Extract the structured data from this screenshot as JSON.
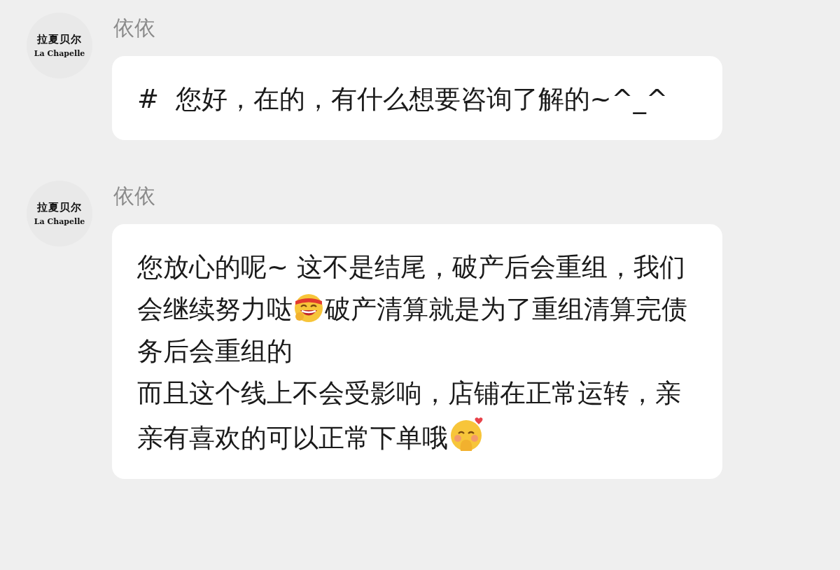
{
  "messages": [
    {
      "sender": "依依",
      "avatar": {
        "name_cn": "拉夏贝尔",
        "name_en": "La Chapelle"
      },
      "paragraphs": [
        [
          {
            "kind": "text",
            "text": "#  您好，在的，有什么想要咨询了解的~^_^"
          }
        ]
      ]
    },
    {
      "sender": "依依",
      "avatar": {
        "name_cn": "拉夏贝尔",
        "name_en": "La Chapelle"
      },
      "paragraphs": [
        [
          {
            "kind": "text",
            "text": "您放心的呢~ 这不是结尾，破产后会重组，我们会继续努力哒"
          },
          {
            "kind": "laugh"
          },
          {
            "kind": "text",
            "text": "破产清算就是为了重组清算完债务后会重组的"
          }
        ],
        [
          {
            "kind": "text",
            "text": "而且这个线上不会受影响，店铺在正常运转，亲亲有喜欢的可以正常下单哦"
          },
          {
            "kind": "shy"
          }
        ]
      ]
    }
  ]
}
